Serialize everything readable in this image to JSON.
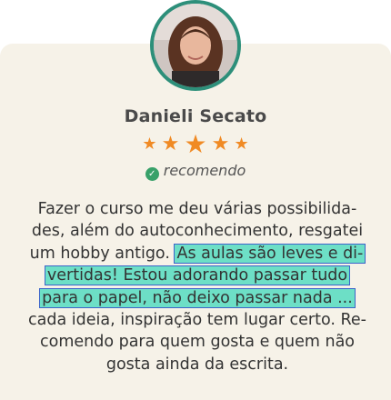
{
  "profile": {
    "name": "Danieli Secato",
    "rating": 5,
    "recommend_icon": "check-badge-icon",
    "recommend_label": "recomendo"
  },
  "colors": {
    "card_background": "#f6f2e8",
    "avatar_ring": "#2d8f7a",
    "stars": "#f08a24",
    "highlight": "#6ddfc6",
    "highlight_outline": "#3b63c9",
    "check_badge": "#38a169"
  },
  "testimonial": {
    "lines": [
      "Fazer o curso me deu várias possibilida-",
      "des, além do autoconhecimento, resgatei",
      "um hobby antigo.",
      "As aulas são leves e di-",
      "vertidas! Estou adorando passar tudo",
      "para o papel, não deixo passar nada ...",
      "cada ideia, inspiração tem lugar certo. Re-",
      "comendo para quem gosta e quem não",
      "gosta ainda da escrita."
    ]
  }
}
